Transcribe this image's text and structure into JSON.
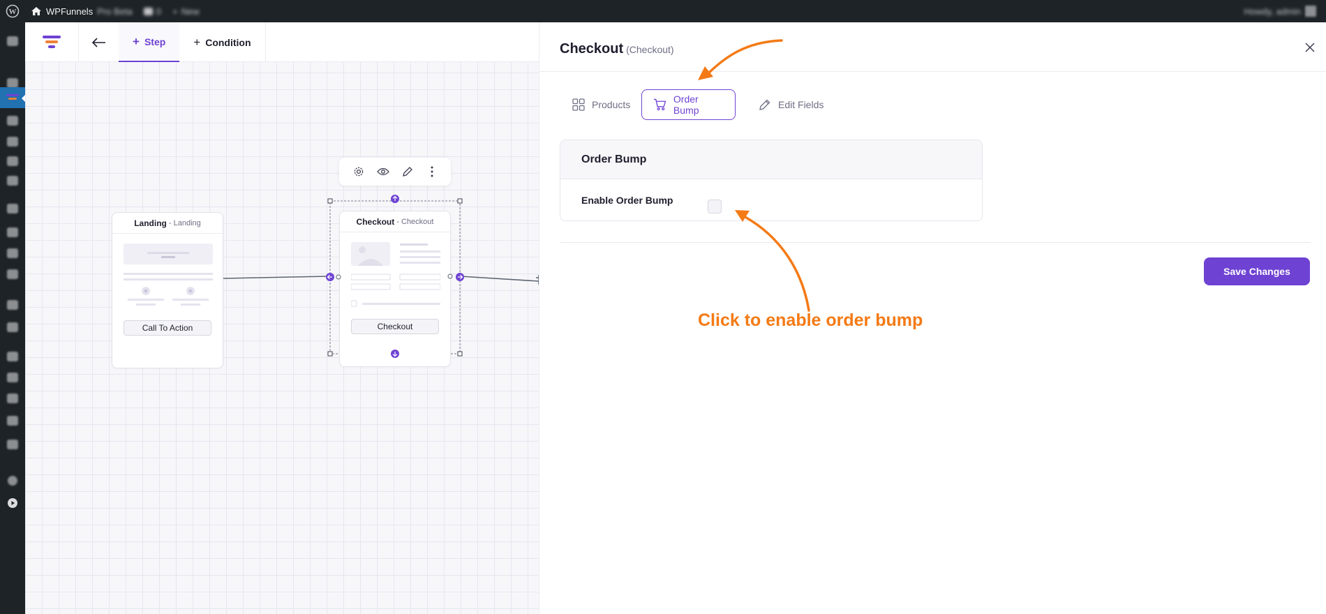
{
  "admin_bar": {
    "site_name": "WPFunnels",
    "site_extra": "Pro Beta",
    "comments_count": "0",
    "new_label": "New",
    "greeting": "Howdy, admin"
  },
  "builder": {
    "tabs": [
      {
        "label": "Step",
        "active": true
      },
      {
        "label": "Condition",
        "active": false
      }
    ],
    "nodes": {
      "landing": {
        "title": "Landing",
        "subtitle": "- Landing",
        "button": "Call To Action"
      },
      "checkout": {
        "title": "Checkout",
        "subtitle": "- Checkout",
        "button": "Checkout"
      }
    }
  },
  "panel": {
    "title": "Checkout",
    "subtitle": "(Checkout)",
    "tabs": [
      {
        "label": "Products",
        "icon": "grid-icon",
        "active": false
      },
      {
        "label": "Order Bump",
        "icon": "cart-icon",
        "active": true
      },
      {
        "label": "Edit Fields",
        "icon": "pencil-icon",
        "active": false
      }
    ],
    "order_bump": {
      "heading": "Order Bump",
      "enable_label": "Enable Order Bump",
      "enabled": false
    },
    "save_label": "Save Changes",
    "annotation": "Click to enable order bump"
  },
  "colors": {
    "accent": "#6e42d3",
    "annotation": "#f47a15",
    "wp_bar": "#1d2327"
  }
}
